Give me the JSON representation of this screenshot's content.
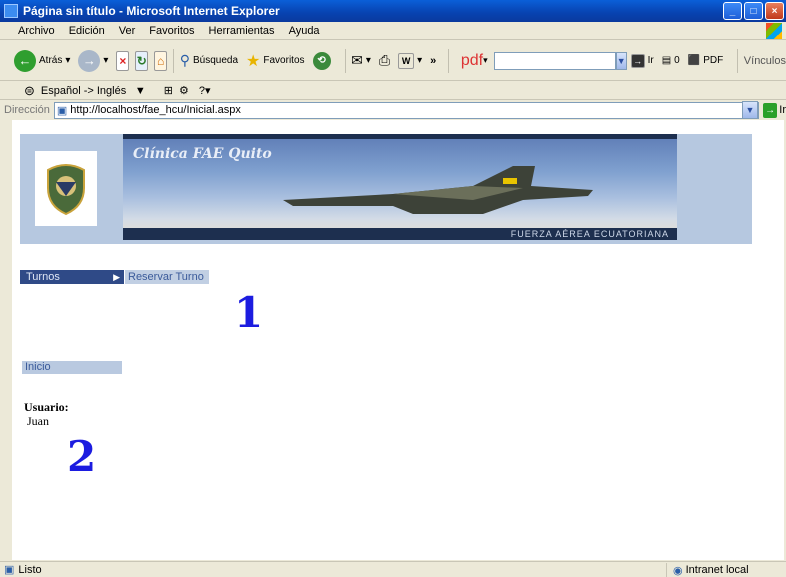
{
  "window": {
    "title": "Página sin título - Microsoft Internet Explorer"
  },
  "menubar": [
    "Archivo",
    "Edición",
    "Ver",
    "Favoritos",
    "Herramientas",
    "Ayuda"
  ],
  "toolbar": {
    "back_label": "Atrás",
    "search_label": "Búsqueda",
    "favorites_label": "Favoritos",
    "pdf_brand": "pdf",
    "ir_label": "Ir",
    "count_label": "0",
    "pdf_label": "PDF",
    "links_label": "Vínculos"
  },
  "linkbar": {
    "translate_label": "Español -> Inglés"
  },
  "address": {
    "label": "Dirección",
    "url": "http://localhost/fae_hcu/Inicial.aspx",
    "go_label": "Ir"
  },
  "page": {
    "banner_title": "Clínica FAE Quito",
    "banner_footer": "FUERZA AÉREA ECUATORIANA",
    "menu_turnos": "Turnos",
    "menu_reservar": "Reservar Turno",
    "marker_1": "1",
    "menu_inicio": "Inicio",
    "user_label": "Usuario:",
    "user_value": "Juan",
    "marker_2": "2"
  },
  "status": {
    "text": "Listo",
    "zone": "Intranet local"
  },
  "colors": {
    "titlebar": "#0A42B0",
    "menu_active": "#2f4a87",
    "menu_inactive": "#c1cfe3",
    "marker": "#1c1ce0"
  }
}
